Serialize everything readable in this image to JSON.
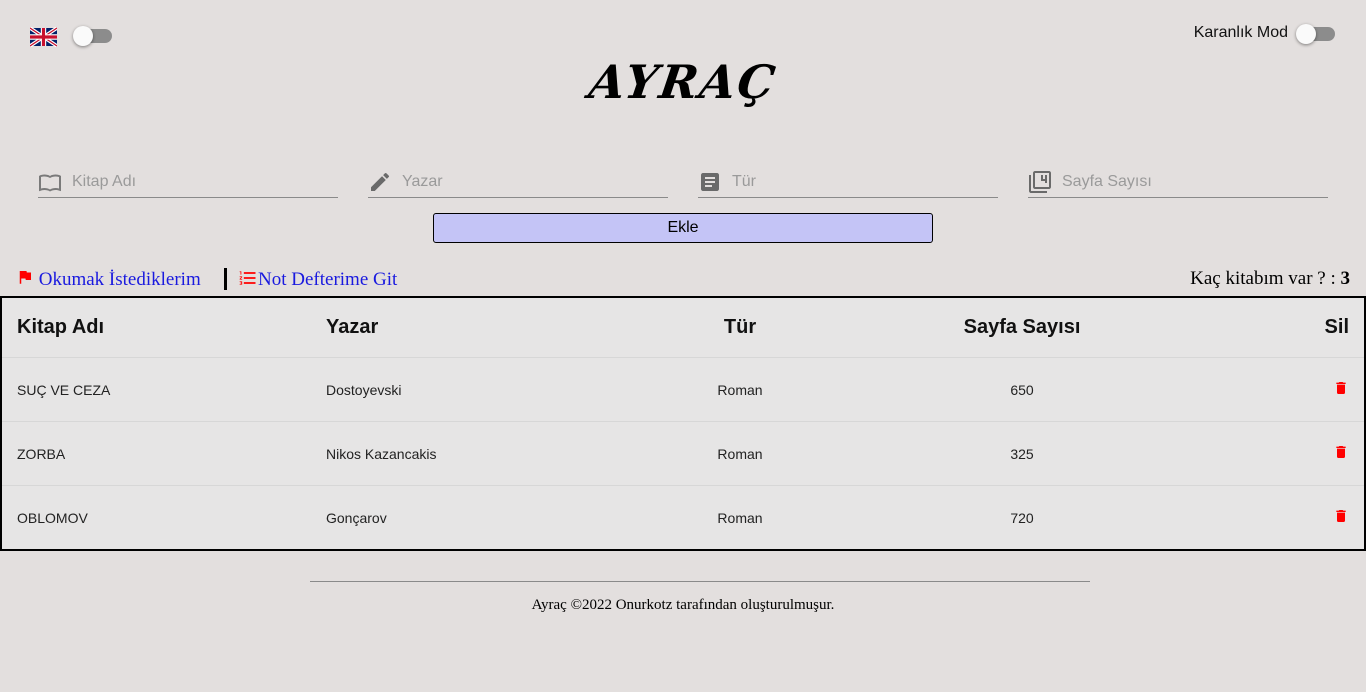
{
  "header": {
    "language_flag": "uk-flag-icon",
    "dark_mode_label": "Karanlık Mod",
    "dark_mode_on": false,
    "language_toggle_on": false
  },
  "logo_text": "AYRAÇ",
  "form": {
    "book_name": {
      "placeholder": "Kitap Adı",
      "value": "",
      "icon": "open-book-icon"
    },
    "author": {
      "placeholder": "Yazar",
      "value": "",
      "icon": "pencil-icon"
    },
    "genre": {
      "placeholder": "Tür",
      "value": "",
      "icon": "document-icon"
    },
    "pages": {
      "placeholder": "Sayfa Sayısı",
      "value": "",
      "icon": "page-count-icon"
    },
    "add_label": "Ekle"
  },
  "links": {
    "read_list": "Okumak İstediklerim",
    "notebook": "Not Defterime Git"
  },
  "count": {
    "label": "Kaç kitabım var ? : ",
    "value": "3"
  },
  "table": {
    "headers": [
      "Kitap Adı",
      "Yazar",
      "Tür",
      "Sayfa Sayısı",
      "Sil"
    ],
    "rows": [
      [
        "SUÇ VE CEZA",
        "Dostoyevski",
        "Roman",
        "650"
      ],
      [
        "ZORBA",
        "Nikos Kazancakis",
        "Roman",
        "325"
      ],
      [
        "OBLOMOV",
        "Gonçarov",
        "Roman",
        "720"
      ]
    ]
  },
  "colors": {
    "accent_button": "#c4c4f6",
    "link": "#1a1adf",
    "delete": "#ff0000",
    "background": "#e3dfde"
  },
  "footer": "Ayraç ©2022 Onurkotz tarafından oluşturulmuşur."
}
